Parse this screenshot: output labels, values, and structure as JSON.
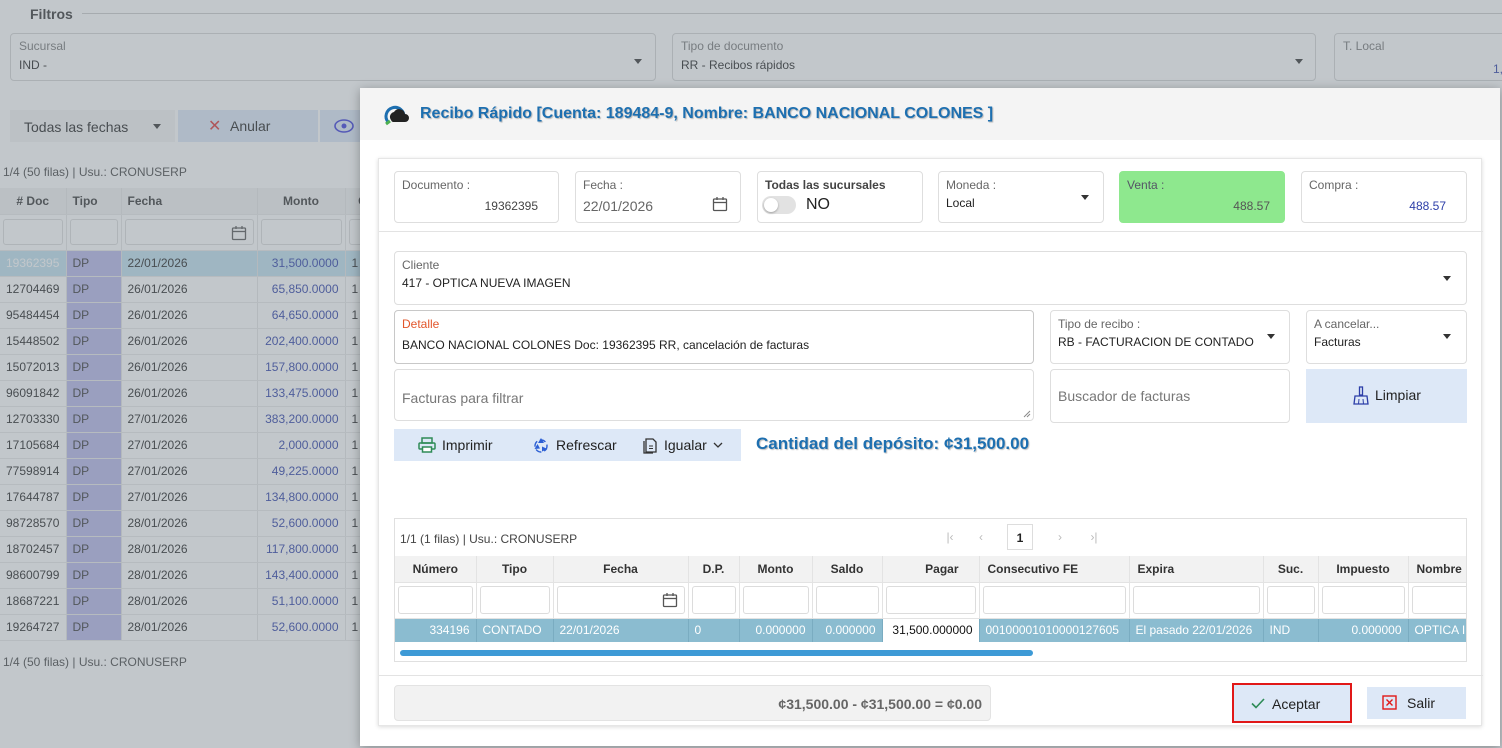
{
  "background": {
    "filters_title": "Filtros",
    "sucursal": {
      "label": "Sucursal",
      "value": "IND -"
    },
    "tipo_documento": {
      "label": "Tipo de documento",
      "value": "RR - Recibos rápidos"
    },
    "t_local": {
      "label": "T. Local",
      "value": "1,"
    },
    "date_filter": "Todas las fechas",
    "anular_button": "Anular",
    "grid_status_top": "1/4 (50 filas) | Usu.: CRONUSERP",
    "grid_status_bottom": "1/4 (50 filas) | Usu.: CRONUSERP",
    "columns": [
      "# Doc",
      "Tipo",
      "Fecha",
      "Monto",
      "C"
    ],
    "rows": [
      {
        "doc": "19362395",
        "tipo": "DP",
        "fecha": "22/01/2026",
        "monto": "31,500.0000",
        "c": "1"
      },
      {
        "doc": "12704469",
        "tipo": "DP",
        "fecha": "26/01/2026",
        "monto": "65,850.0000",
        "c": "1"
      },
      {
        "doc": "95484454",
        "tipo": "DP",
        "fecha": "26/01/2026",
        "monto": "64,650.0000",
        "c": "1"
      },
      {
        "doc": "15448502",
        "tipo": "DP",
        "fecha": "26/01/2026",
        "monto": "202,400.0000",
        "c": "1"
      },
      {
        "doc": "15072013",
        "tipo": "DP",
        "fecha": "26/01/2026",
        "monto": "157,800.0000",
        "c": "1"
      },
      {
        "doc": "96091842",
        "tipo": "DP",
        "fecha": "26/01/2026",
        "monto": "133,475.0000",
        "c": "1"
      },
      {
        "doc": "12703330",
        "tipo": "DP",
        "fecha": "27/01/2026",
        "monto": "383,200.0000",
        "c": "1"
      },
      {
        "doc": "17105684",
        "tipo": "DP",
        "fecha": "27/01/2026",
        "monto": "2,000.0000",
        "c": "1"
      },
      {
        "doc": "77598914",
        "tipo": "DP",
        "fecha": "27/01/2026",
        "monto": "49,225.0000",
        "c": "1"
      },
      {
        "doc": "17644787",
        "tipo": "DP",
        "fecha": "27/01/2026",
        "monto": "134,800.0000",
        "c": "1"
      },
      {
        "doc": "98728570",
        "tipo": "DP",
        "fecha": "28/01/2026",
        "monto": "52,600.0000",
        "c": "1"
      },
      {
        "doc": "18702457",
        "tipo": "DP",
        "fecha": "28/01/2026",
        "monto": "117,800.0000",
        "c": "1"
      },
      {
        "doc": "98600799",
        "tipo": "DP",
        "fecha": "28/01/2026",
        "monto": "143,400.0000",
        "c": "1"
      },
      {
        "doc": "18687221",
        "tipo": "DP",
        "fecha": "28/01/2026",
        "monto": "51,100.0000",
        "c": "1"
      },
      {
        "doc": "19264727",
        "tipo": "DP",
        "fecha": "28/01/2026",
        "monto": "52,600.0000",
        "c": "1"
      }
    ]
  },
  "modal": {
    "title": "Recibo Rápido [Cuenta: 189484-9, Nombre: BANCO NACIONAL COLONES ]",
    "documento": {
      "label": "Documento :",
      "value": "19362395"
    },
    "fecha": {
      "label": "Fecha :",
      "value": "22/01/2026"
    },
    "todas_sucursales": {
      "label": "Todas las sucursales",
      "value": "NO"
    },
    "moneda": {
      "label": "Moneda :",
      "value": "Local"
    },
    "venta": {
      "label": "Venta :",
      "value": "488.57"
    },
    "compra": {
      "label": "Compra :",
      "value": "488.57"
    },
    "cliente": {
      "label": "Cliente",
      "value": "417 - OPTICA NUEVA IMAGEN"
    },
    "detalle": {
      "label": "Detalle",
      "value": "BANCO NACIONAL COLONES Doc: 19362395 RR, cancelación de facturas"
    },
    "tipo_recibo": {
      "label": "Tipo de recibo :",
      "value": "RB - FACTURACION DE CONTADO"
    },
    "a_cancelar": {
      "label": "A cancelar...",
      "value": "Facturas"
    },
    "facturas_placeholder": "Facturas para filtrar",
    "buscador_placeholder": "Buscador de facturas",
    "limpiar_button": "Limpiar",
    "toolbar": {
      "imprimir": "Imprimir",
      "refrescar": "Refrescar",
      "igualar": "Igualar"
    },
    "deposito": "Cantidad del depósito: ¢31,500.00",
    "inner_grid": {
      "status": "1/1 (1 filas) | Usu.: CRONUSERP",
      "page": "1",
      "columns": [
        "Número",
        "Tipo",
        "Fecha",
        "D.P.",
        "Monto",
        "Saldo",
        "Pagar",
        "Consecutivo FE",
        "Expira",
        "Suc.",
        "Impuesto",
        "Nombre"
      ],
      "row": {
        "numero": "334196",
        "tipo": "CONTADO",
        "fecha": "22/01/2026",
        "dp": "0",
        "monto": "0.000000",
        "saldo": "0.000000",
        "pagar": "31,500.000000",
        "consecutivo": "00100001010000127605",
        "expira": "El pasado 22/01/2026",
        "suc": "IND",
        "impuesto": "0.000000",
        "nombre": "OPTICA I"
      }
    },
    "balance": "¢31,500.00 - ¢31,500.00 = ¢0.00",
    "aceptar_button": "Aceptar",
    "salir_button": "Salir"
  },
  "colors": {
    "title_blue": "#1d6fb0",
    "venta_green": "#8ee88e",
    "selected_row": "#8bbcd0",
    "tipo_purple": "#b7b7ea",
    "aceptar_border": "#e11818"
  }
}
